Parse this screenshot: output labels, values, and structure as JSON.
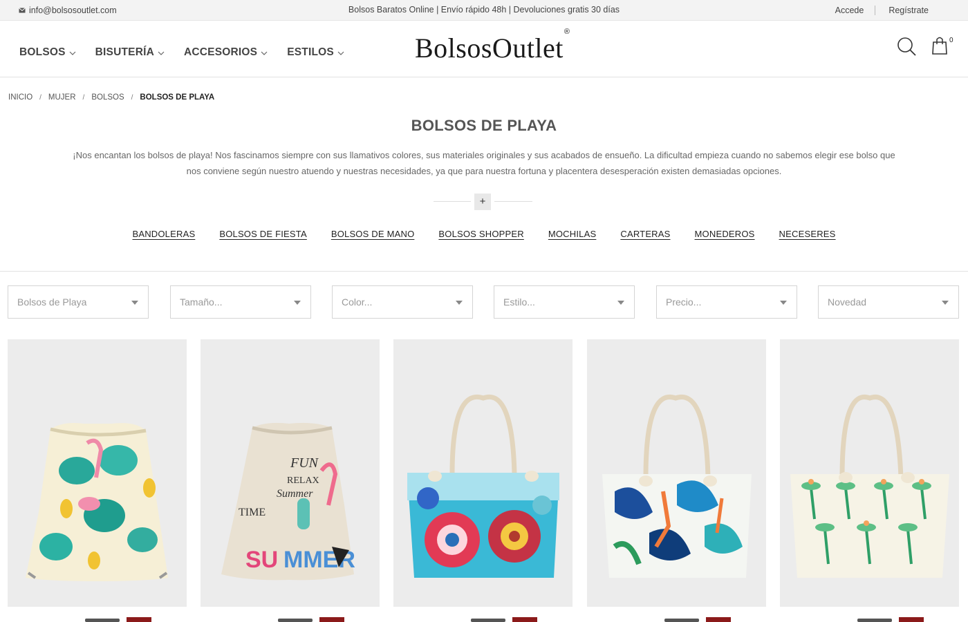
{
  "topbar": {
    "email": "info@bolsosoutlet.com",
    "promo": "Bolsos Baratos Online | Envío rápido 48h | Devoluciones gratis 30 días",
    "login": "Accede",
    "register": "Regístrate"
  },
  "header": {
    "logo": "BolsosOutlet",
    "logo_mark": "®",
    "nav": [
      {
        "label": "BOLSOS"
      },
      {
        "label": "BISUTERÍA"
      },
      {
        "label": "ACCESORIOS"
      },
      {
        "label": "ESTILOS"
      }
    ],
    "cart_count": "0"
  },
  "breadcrumb": [
    "INICIO",
    "MUJER",
    "BOLSOS",
    "BOLSOS DE PLAYA"
  ],
  "page_title": "BOLSOS DE PLAYA",
  "description_line1": "¡Nos encantan los bolsos de playa! Nos fascinamos siempre con sus llamativos colores, sus materiales originales y sus acabados de ensueño. La dificultad empieza cuando no sabemos elegir ese bolso que",
  "description_line2": "nos conviene según nuestro atuendo y nuestras necesidades, ya que para nuestra fortuna y placentera desesperación existen demasiadas opciones.",
  "more_button": "+",
  "subcategories": [
    "BANDOLERAS",
    "BOLSOS DE FIESTA",
    "BOLSOS DE MANO",
    "BOLSOS SHOPPER",
    "MOCHILAS",
    "CARTERAS",
    "MONEDEROS",
    "NECESERES"
  ],
  "filters": [
    {
      "value": "Bolsos de Playa"
    },
    {
      "placeholder": "Tamaño..."
    },
    {
      "placeholder": "Color..."
    },
    {
      "placeholder": "Estilo..."
    },
    {
      "placeholder": "Precio..."
    },
    {
      "value": "Novedad"
    }
  ],
  "products": [
    {
      "image": "drawstring-backpack-flamingo-pineapple"
    },
    {
      "image": "drawstring-backpack-summer-fun"
    },
    {
      "image": "beach-tote-mandala"
    },
    {
      "image": "beach-tote-tropical-leaves"
    },
    {
      "image": "beach-tote-palm-trees"
    }
  ],
  "colors": {
    "badge": "#8b1a1a",
    "topbar_bg": "#f3f3f3",
    "product_bg": "#ececec"
  }
}
